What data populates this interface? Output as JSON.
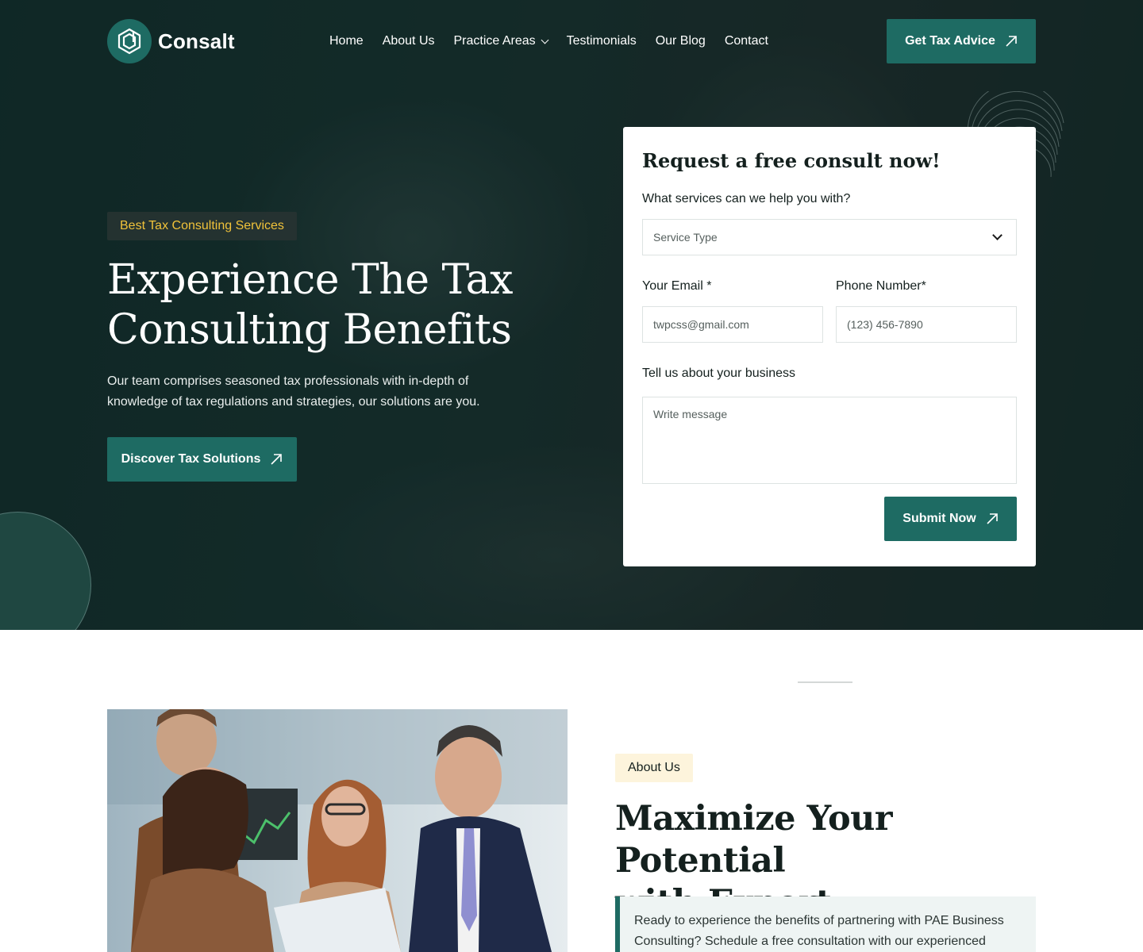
{
  "brand": {
    "name": "Consalt",
    "accent": "#1e6b63",
    "tag_yellow": "#f0c23a"
  },
  "nav": {
    "items": [
      {
        "label": "Home"
      },
      {
        "label": "About Us"
      },
      {
        "label": "Practice Areas",
        "has_dropdown": true
      },
      {
        "label": "Testimonials"
      },
      {
        "label": "Our Blog"
      },
      {
        "label": "Contact"
      }
    ],
    "cta_label": "Get Tax Advice"
  },
  "hero": {
    "tag": "Best Tax Consulting Services",
    "title_line1": "Experience The Tax",
    "title_line2": "Consulting Benefits",
    "description": "Our team comprises seasoned tax professionals with in-depth of knowledge of tax regulations and strategies, our solutions are you.",
    "button_label": "Discover Tax Solutions"
  },
  "form": {
    "title": "Request a free consult now!",
    "service_label": "What services can we help you with?",
    "service_placeholder": "Service Type",
    "email_label": "Your Email *",
    "email_placeholder": "twpcss@gmail.com",
    "phone_label": "Phone Number*",
    "phone_placeholder": "(123) 456-7890",
    "message_label": "Tell us about your business",
    "message_placeholder": "Write message",
    "submit_label": "Submit Now"
  },
  "about": {
    "tag": "About Us",
    "title_line1": "Maximize Your Potential",
    "title_line2": "with Expert Consultation",
    "quote": "Ready to experience the benefits of partnering with PAE Business Consulting? Schedule a free consultation with our experienced"
  }
}
